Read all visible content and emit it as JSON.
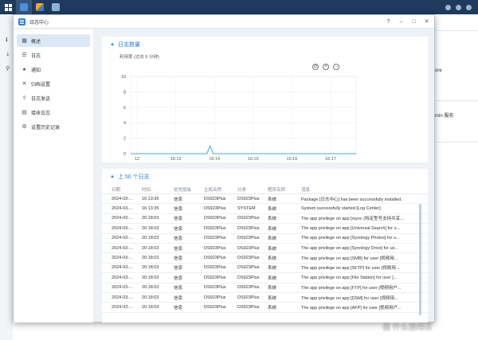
{
  "window": {
    "title": "日志中心",
    "controls": [
      "?",
      "–",
      "□",
      "✕"
    ]
  },
  "sidebar": {
    "items": [
      {
        "label": "概述",
        "icon": "overview-icon",
        "glyph": "▦"
      },
      {
        "label": "日志",
        "icon": "log-icon",
        "glyph": "☰"
      },
      {
        "label": "通知",
        "icon": "notification-icon",
        "glyph": "●"
      },
      {
        "label": "归档设置",
        "icon": "archive-settings-icon",
        "glyph": "✕"
      },
      {
        "label": "日志发送",
        "icon": "log-sending-icon",
        "glyph": "⇪"
      },
      {
        "label": "接收日志",
        "icon": "receive-log-icon",
        "glyph": "▤"
      },
      {
        "label": "设置历史记录",
        "icon": "settings-history-icon",
        "glyph": "⚙"
      }
    ]
  },
  "log_count_panel": {
    "title": "日志数量",
    "subtitle": "利用率 (过去 6 分钟)"
  },
  "chart_data": {
    "type": "line",
    "title": "日志数量",
    "subtitle": "利用率 (过去 6 分钟)",
    "x_ticks": [
      "12",
      "16:13",
      "16:14",
      "16:15",
      "16:16",
      "16:17"
    ],
    "y_ticks": [
      "0",
      "2",
      "4",
      "6",
      "8",
      "10"
    ],
    "ylim": [
      0,
      10
    ],
    "series": [
      {
        "values": [
          0,
          0,
          0,
          0,
          0,
          0,
          0,
          0,
          0,
          0,
          0,
          0,
          0,
          0,
          0,
          0,
          0,
          0,
          0,
          0,
          0,
          0,
          0,
          0,
          0,
          1,
          0,
          0,
          0,
          0,
          0,
          0,
          0,
          0,
          0,
          0,
          0,
          0,
          0,
          0,
          0,
          0,
          0,
          0,
          0,
          0,
          0,
          0,
          0,
          0,
          0,
          0,
          0,
          0,
          0,
          0,
          0,
          0,
          0,
          0,
          0,
          0,
          0,
          0,
          0,
          0,
          0,
          0,
          0,
          0,
          0,
          0
        ],
        "color": "#3fa9e0"
      }
    ],
    "grid": true,
    "tools": [
      "reset-zoom-icon",
      "zoom-in-icon",
      "zoom-out-icon"
    ]
  },
  "log_table": {
    "title": "上 50 个日志",
    "columns": [
      "日期",
      "时间",
      "优先层级",
      "主机名称",
      "分类",
      "程序名称",
      "消息"
    ],
    "rows": [
      [
        "2024-03-...",
        "16:13:36",
        "信息",
        "DS923Plus",
        "DS923Plus",
        "系统",
        "Package [日志中心] has been successfully installed."
      ],
      [
        "2024-03-...",
        "16:13:35",
        "信息",
        "DS923Plus",
        "SYSTEM",
        "系统",
        "System successfully started [Log Center]."
      ],
      [
        "2024-03-...",
        "20:18:03",
        "信息",
        "DS923Plus",
        "DS923Plus",
        "系统",
        "The app privilege on app [rsync (特定型号支持共享..."
      ],
      [
        "2024-03-...",
        "20:18:03",
        "信息",
        "DS923Plus",
        "DS923Plus",
        "系统",
        "The app privilege on app [Universal Search] for u..."
      ],
      [
        "2024-03-...",
        "20:18:03",
        "信息",
        "DS923Plus",
        "DS923Plus",
        "系统",
        "The app privilege on app [Synology Photos] for u..."
      ],
      [
        "2024-03-...",
        "20:18:03",
        "信息",
        "DS923Plus",
        "DS923Plus",
        "系统",
        "The app privilege on app [Synology Drive] for us..."
      ],
      [
        "2024-03-...",
        "20:18:03",
        "信息",
        "DS923Plus",
        "DS923Plus",
        "系统",
        "The app privilege on app [SMB] for user [视频用..."
      ],
      [
        "2024-03-...",
        "20:18:03",
        "信息",
        "DS923Plus",
        "DS923Plus",
        "系统",
        "The app privilege on app [SFTP] for user [视频用..."
      ],
      [
        "2024-03-...",
        "20:18:03",
        "信息",
        "DS923Plus",
        "DS923Plus",
        "系统",
        "The app privilege on app [File Station] for user [..."
      ],
      [
        "2024-03-...",
        "20:18:03",
        "信息",
        "DS923Plus",
        "DS923Plus",
        "系统",
        "The app privilege on app [FTP] for user [视频用户..."
      ],
      [
        "2024-03-...",
        "20:18:03",
        "信息",
        "DS923Plus",
        "DS923Plus",
        "系统",
        "The app privilege on app [DSM] for user [视频用..."
      ],
      [
        "2024-03-...",
        "20:18:03",
        "信息",
        "DS923Plus",
        "DS923Plus",
        "系统",
        "The app privilege on app [AFP] for user [视频用户..."
      ]
    ]
  },
  "background_app": {
    "texts": [
      "ore",
      "min 服务"
    ]
  },
  "watermark": "值 什么值得买"
}
